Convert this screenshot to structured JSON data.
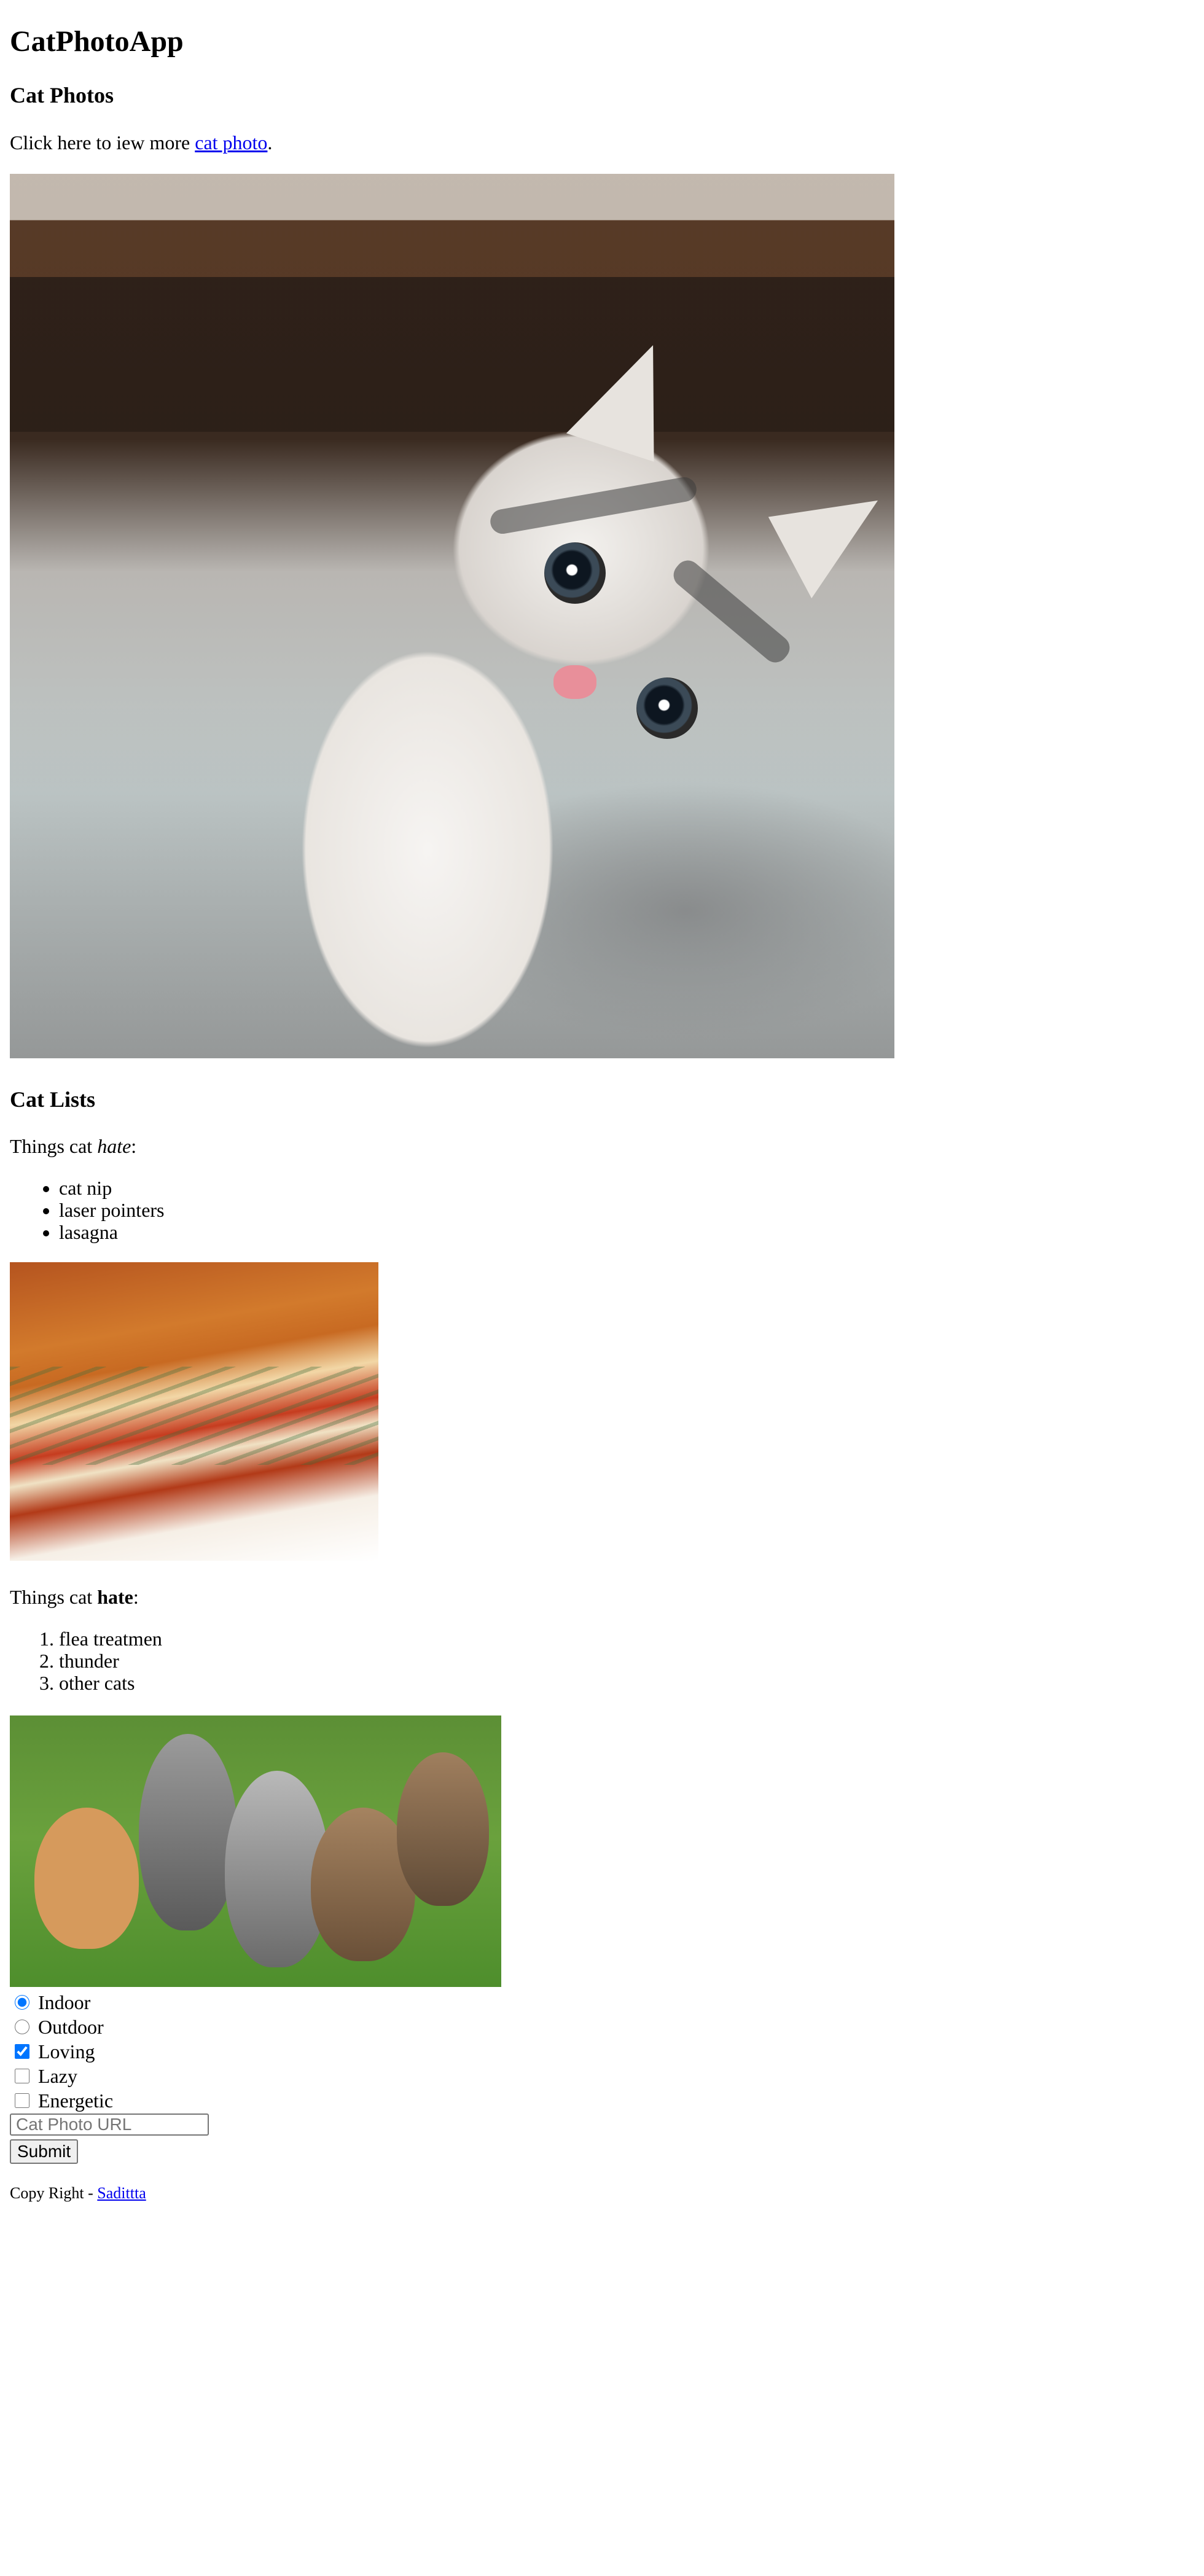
{
  "header": {
    "app_title": "CatPhotoApp"
  },
  "photos_section": {
    "heading": "Cat Photos",
    "intro_prefix": "Click here to iew more ",
    "intro_link": "cat photo",
    "intro_suffix": "."
  },
  "lists_section": {
    "heading": "Cat Lists",
    "loves_prefix": "Things cat ",
    "loves_emphasis": "hate",
    "loves_suffix": ":",
    "loves_items": [
      "cat nip",
      "laser pointers",
      "lasagna"
    ],
    "hates_prefix": "Things cat ",
    "hates_emphasis": "hate",
    "hates_suffix": ":",
    "hates_items": [
      "flea treatmen",
      "thunder",
      "other cats"
    ]
  },
  "form": {
    "radios": [
      {
        "label": "Indoor",
        "checked": true
      },
      {
        "label": "Outdoor",
        "checked": false
      }
    ],
    "checkboxes": [
      {
        "label": "Loving",
        "checked": true
      },
      {
        "label": "Lazy",
        "checked": false
      },
      {
        "label": "Energetic",
        "checked": false
      }
    ],
    "url_placeholder": "Cat Photo URL",
    "submit_label": "Submit"
  },
  "footer": {
    "copyright_prefix": "Copy Right - ",
    "copyright_link": "Sadittta"
  }
}
